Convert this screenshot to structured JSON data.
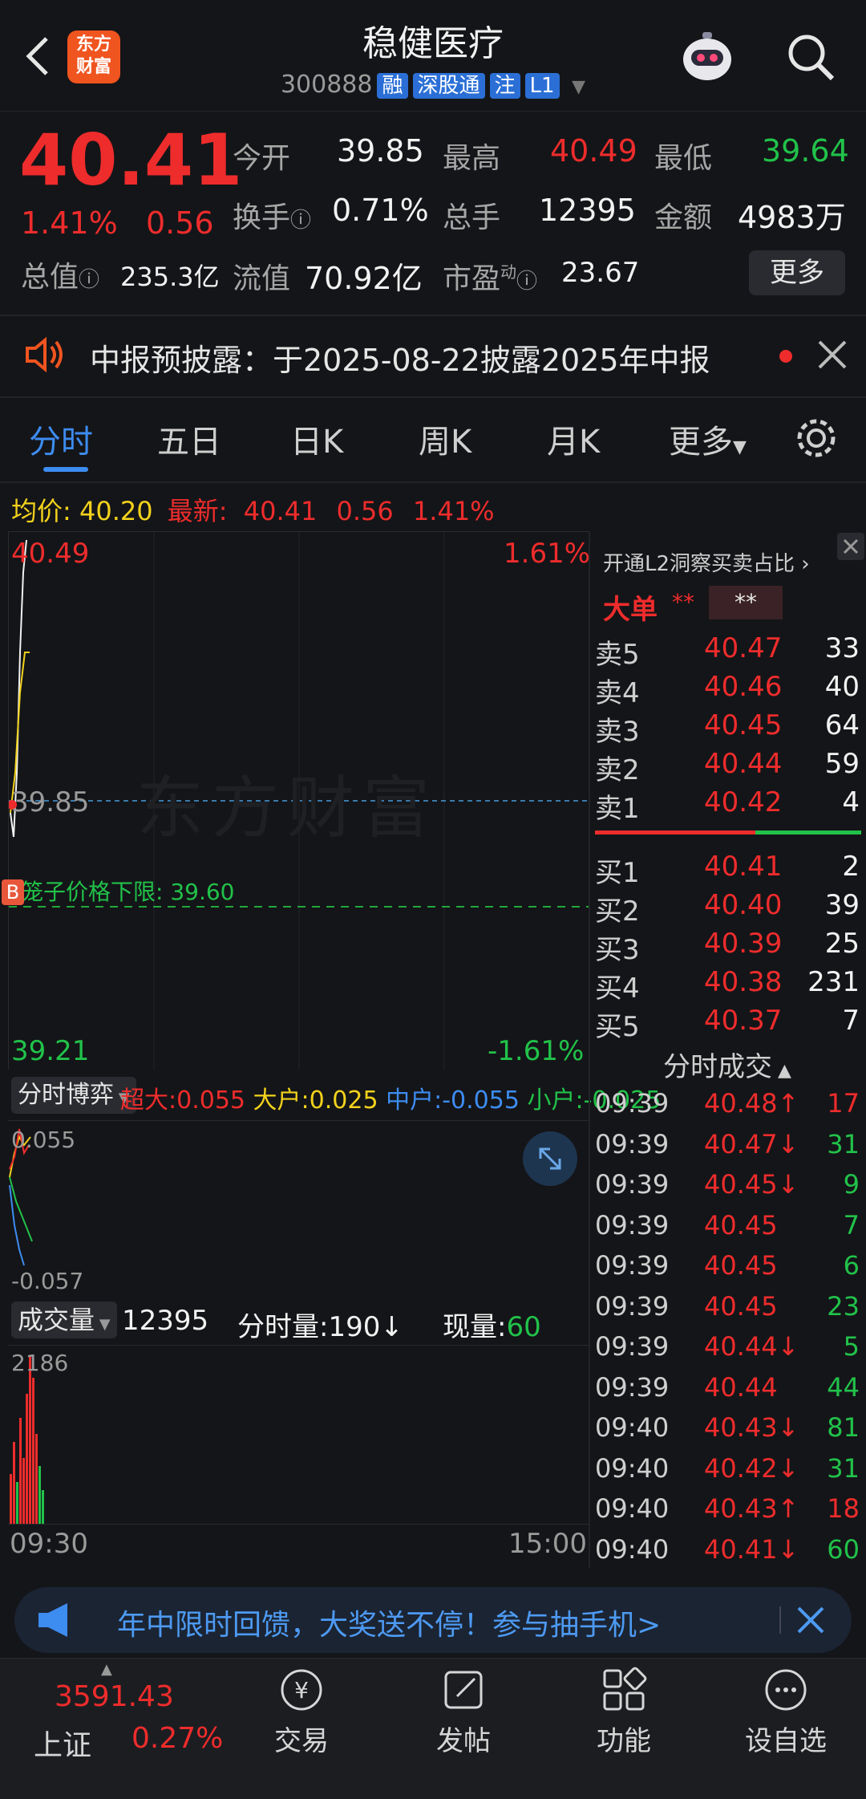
{
  "header": {
    "title": "稳健医疗",
    "logo_text": "东方财富",
    "code": "300888",
    "tags": [
      "融",
      "深股通",
      "注",
      "L1"
    ]
  },
  "quote": {
    "price": "40.41",
    "change_pct": "1.41%",
    "change": "0.56",
    "open_label": "今开",
    "open": "39.85",
    "high_label": "最高",
    "high": "40.49",
    "low_label": "最低",
    "low": "39.64",
    "turnover_label": "换手",
    "turnover": "0.71%",
    "volume_label": "总手",
    "volume": "12395",
    "amount_label": "金额",
    "amount": "4983万",
    "mktcap_label": "总值",
    "mktcap": "235.3亿",
    "float_label": "流值",
    "float": "70.92亿",
    "pe_label": "市盈",
    "pe_sup": "动",
    "pe": "23.67",
    "more_label": "更多"
  },
  "notice": {
    "text": "中报预披露：于2025-08-22披露2025年中报"
  },
  "tabs": [
    "分时",
    "五日",
    "日K",
    "周K",
    "月K",
    "更多"
  ],
  "chart_info": {
    "avg_label": "均价:",
    "avg": "40.20",
    "latest_label": "最新:",
    "latest": "40.41",
    "latest_chg": "0.56",
    "latest_pct": "1.41%",
    "y_top": "40.49",
    "y_top_pct": "1.61%",
    "y_mid": "39.85",
    "y_bottom": "39.21",
    "y_bottom_pct": "-1.61%",
    "cage_label": "笼子价格下限: 39.60",
    "watermark": "东方财富",
    "b_marker": "B"
  },
  "fund": {
    "dropdown": "分时博弈",
    "xl_label": "超大:",
    "xl": "0.055",
    "l_label": "大户:",
    "l": "0.025",
    "m_label": "中户:",
    "m": "-0.055",
    "s_label": "小户:",
    "s": "-0.025",
    "top": "0.055",
    "bottom": "-0.057"
  },
  "volume": {
    "dropdown": "成交量",
    "total": "12395",
    "period_label": "分时量:",
    "period": "190",
    "now_label": "现量:",
    "now": "60",
    "max": "2186",
    "start_time": "09:30",
    "end_time": "15:00"
  },
  "orderbook": {
    "l2_label": "开通L2洞察买卖占比",
    "big_label": "大单",
    "big_val1": "**",
    "big_val2": "**",
    "asks": [
      {
        "label": "卖5",
        "price": "40.47",
        "vol": "33"
      },
      {
        "label": "卖4",
        "price": "40.46",
        "vol": "40"
      },
      {
        "label": "卖3",
        "price": "40.45",
        "vol": "64"
      },
      {
        "label": "卖2",
        "price": "40.44",
        "vol": "59"
      },
      {
        "label": "卖1",
        "price": "40.42",
        "vol": "4"
      }
    ],
    "bids": [
      {
        "label": "买1",
        "price": "40.41",
        "vol": "2"
      },
      {
        "label": "买2",
        "price": "40.40",
        "vol": "39"
      },
      {
        "label": "买3",
        "price": "40.39",
        "vol": "25"
      },
      {
        "label": "买4",
        "price": "40.38",
        "vol": "231"
      },
      {
        "label": "买5",
        "price": "40.37",
        "vol": "7"
      }
    ]
  },
  "trades": {
    "title": "分时成交",
    "rows": [
      {
        "time": "09:39",
        "price": "40.48↑",
        "vol": "17",
        "dir": "up"
      },
      {
        "time": "09:39",
        "price": "40.47↓",
        "vol": "31",
        "dir": "down"
      },
      {
        "time": "09:39",
        "price": "40.45↓",
        "vol": "9",
        "dir": "down"
      },
      {
        "time": "09:39",
        "price": "40.45",
        "vol": "7",
        "dir": "down"
      },
      {
        "time": "09:39",
        "price": "40.45",
        "vol": "6",
        "dir": "down"
      },
      {
        "time": "09:39",
        "price": "40.45",
        "vol": "23",
        "dir": "down"
      },
      {
        "time": "09:39",
        "price": "40.44↓",
        "vol": "5",
        "dir": "down"
      },
      {
        "time": "09:39",
        "price": "40.44",
        "vol": "44",
        "dir": "down"
      },
      {
        "time": "09:40",
        "price": "40.43↓",
        "vol": "81",
        "dir": "down"
      },
      {
        "time": "09:40",
        "price": "40.42↓",
        "vol": "31",
        "dir": "down"
      },
      {
        "time": "09:40",
        "price": "40.43↑",
        "vol": "18",
        "dir": "up"
      },
      {
        "time": "09:40",
        "price": "40.41↓",
        "vol": "60",
        "dir": "down"
      }
    ]
  },
  "promo": {
    "text": "年中限时回馈，大奖送不停！参与抽手机>"
  },
  "bottom_nav": {
    "index_value": "3591.43",
    "index_name": "上证",
    "index_pct": "0.27%",
    "items": [
      "交易",
      "发帖",
      "功能",
      "设自选"
    ]
  }
}
